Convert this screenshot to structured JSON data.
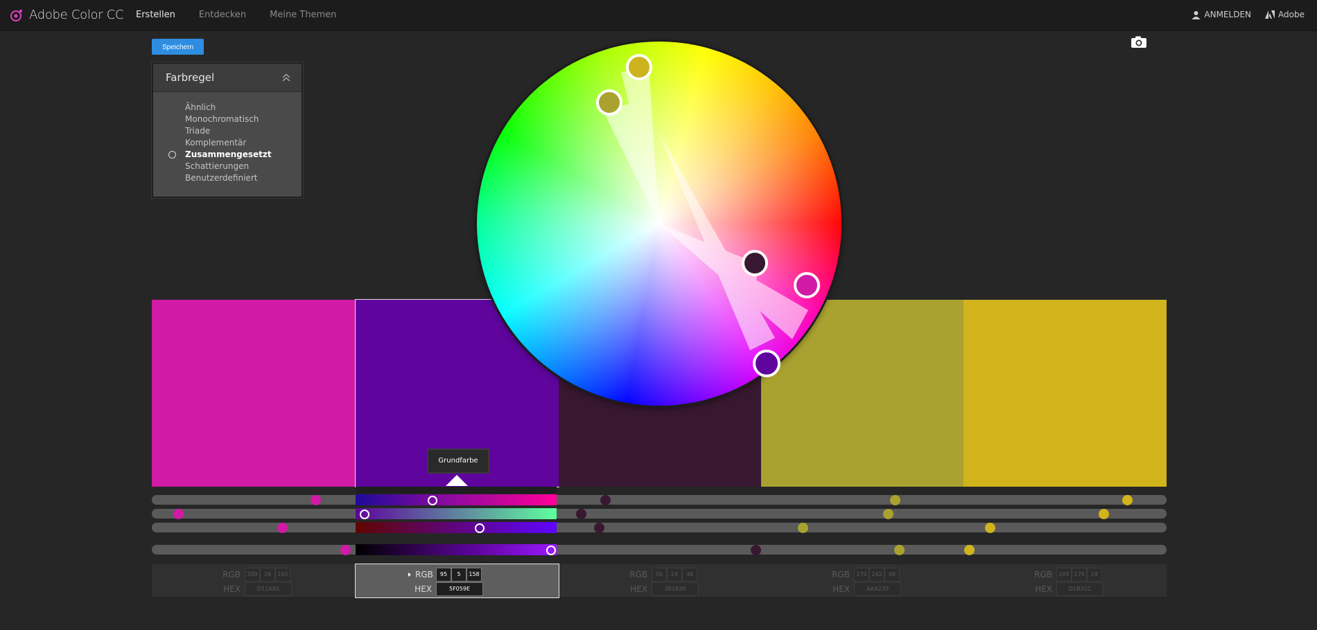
{
  "app": {
    "title": "Adobe Color CC"
  },
  "nav": {
    "items": [
      "Erstellen",
      "Entdecken",
      "Meine Themen"
    ],
    "active": 0
  },
  "topright": {
    "login": "ANMELDEN",
    "adobe": "Adobe"
  },
  "toolbar": {
    "save_label": "Speichern"
  },
  "panel": {
    "title": "Farbregel",
    "rules": [
      "Ähnlich",
      "Monochromatisch",
      "Triade",
      "Komplementär",
      "Zusammengesetzt",
      "Schattierungen",
      "Benutzerdefiniert"
    ],
    "selected": "Zusammengesetzt"
  },
  "tooltip": {
    "label": "Grundfarbe"
  },
  "swatches": [
    {
      "hex": "#D11AA5",
      "rgb": [
        "209",
        "26",
        "165"
      ],
      "hex_label": "D11AA5"
    },
    {
      "hex": "#5F059E",
      "rgb": [
        "95",
        "5",
        "158"
      ],
      "hex_label": "5F059E",
      "active": true
    },
    {
      "hex": "#381830",
      "rgb": [
        "56",
        "24",
        "48"
      ],
      "hex_label": "381830"
    },
    {
      "hex": "#AAA230",
      "rgb": [
        "170",
        "162",
        "48"
      ],
      "hex_label": "AAA230"
    },
    {
      "hex": "#D1B31C",
      "rgb": [
        "209",
        "179",
        "28"
      ],
      "hex_label": "D1B31C"
    }
  ],
  "labels": {
    "rgb": "RGB",
    "hex": "HEX"
  },
  "icons": {
    "logo": "adobe-color-logo-icon",
    "user": "user-icon",
    "adobe": "adobe-logo-icon",
    "camera": "camera-icon",
    "collapse": "chevron-up-double-icon",
    "expand": "triangle-right-icon"
  }
}
